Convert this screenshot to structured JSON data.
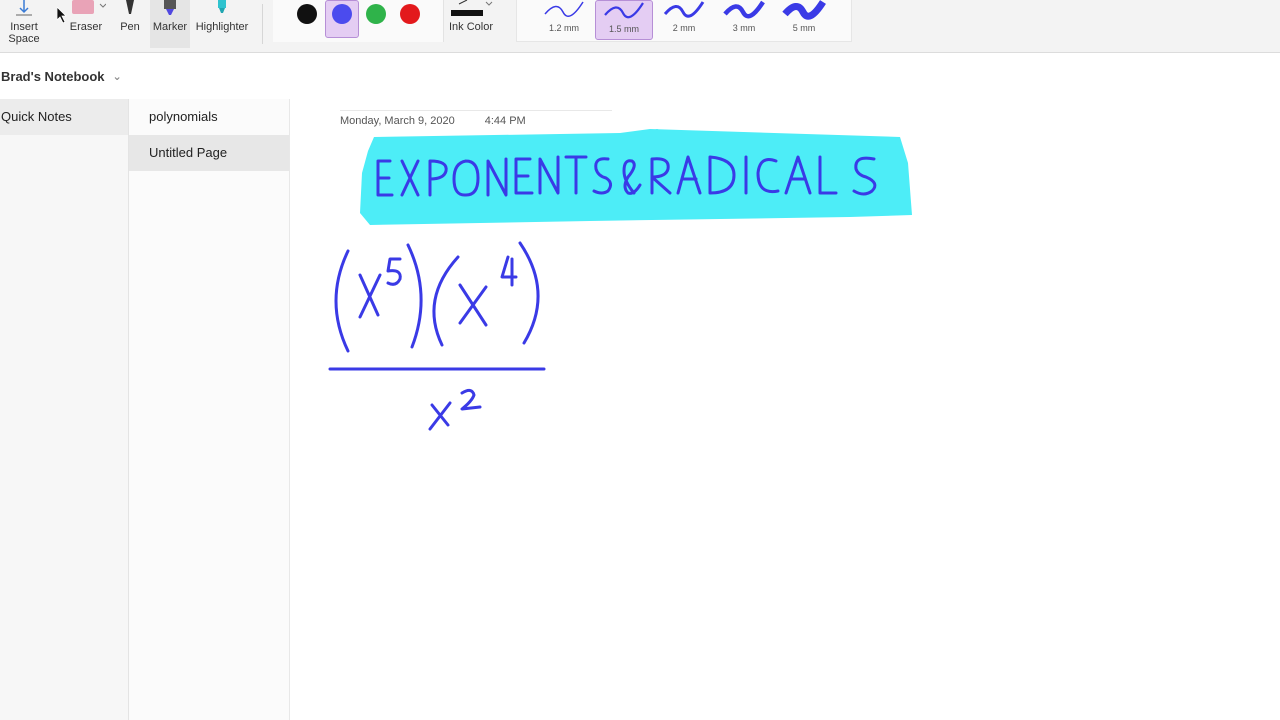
{
  "toolbar": {
    "insert_space": "Insert Space",
    "eraser": "Eraser",
    "pen": "Pen",
    "marker": "Marker",
    "highlighter": "Highlighter",
    "ink_color": "Ink Color",
    "colors": [
      "#111111",
      "#4b4bee",
      "#2fb34a",
      "#e3191c"
    ],
    "selected_color": "#4b4bee",
    "sizes": [
      "1.2 mm",
      "1.5 mm",
      "2 mm",
      "3 mm",
      "5 mm"
    ],
    "selected_size": "1.5 mm"
  },
  "notebook": {
    "name": "Brad's Notebook",
    "sections": [
      {
        "label": "Quick Notes"
      }
    ],
    "pages": [
      {
        "label": "polynomials"
      },
      {
        "label": "Untitled Page"
      }
    ],
    "selected_page": "Untitled Page"
  },
  "page": {
    "date": "Monday, March 9, 2020",
    "time": "4:44 PM",
    "ink_title": "EXPONENTS & RADICALS",
    "highlight_color": "#4dedf7",
    "ink_color": "#3a3ae6",
    "expression": {
      "numerator": "(x⁵)(x⁴)",
      "denominator": "x²"
    }
  }
}
